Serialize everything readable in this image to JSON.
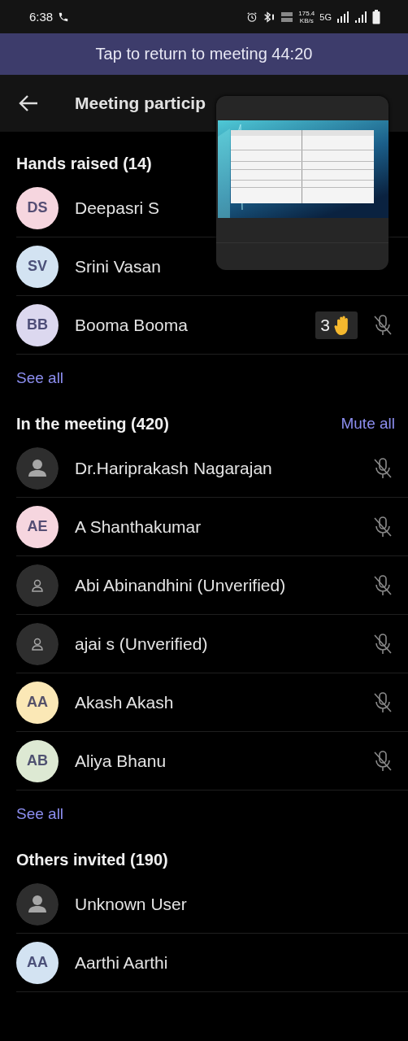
{
  "status_bar": {
    "time": "6:38",
    "speed": "175.4",
    "speed_unit": "KB/s",
    "network": "5G"
  },
  "banner": {
    "text": "Tap to return to meeting 44:20"
  },
  "header": {
    "title": "Meeting particip"
  },
  "sections": [
    {
      "title": "Hands raised (14)",
      "participants": [
        {
          "name": "Deepasri S",
          "avatar": {
            "kind": "initials",
            "initials": "DS",
            "color": "#f6d6df"
          }
        },
        {
          "name": "Srini Vasan",
          "avatar": {
            "kind": "initials",
            "initials": "SV",
            "color": "#d3e3f2"
          }
        },
        {
          "name": "Booma Booma",
          "avatar": {
            "kind": "initials",
            "initials": "BB",
            "color": "#dcd8ef"
          },
          "hand": "3",
          "muted": true
        }
      ],
      "see_all": "See all"
    },
    {
      "title": "In the meeting (420)",
      "action": "Mute all",
      "participants": [
        {
          "name": "Dr.Hariprakash Nagarajan",
          "avatar": {
            "kind": "person"
          },
          "muted": true
        },
        {
          "name": "A Shanthakumar",
          "avatar": {
            "kind": "initials",
            "initials": "AE",
            "color": "#f6d6df"
          },
          "muted": true
        },
        {
          "name": "Abi Abinandhini (Unverified)",
          "avatar": {
            "kind": "unverified"
          },
          "muted": true
        },
        {
          "name": "ajai s (Unverified)",
          "avatar": {
            "kind": "unverified"
          },
          "muted": true
        },
        {
          "name": "Akash Akash",
          "avatar": {
            "kind": "initials",
            "initials": "AA",
            "color": "#fbe8b6"
          },
          "muted": true
        },
        {
          "name": "Aliya Bhanu",
          "avatar": {
            "kind": "initials",
            "initials": "AB",
            "color": "#dde9d3"
          },
          "muted": true
        }
      ],
      "see_all": "See all"
    },
    {
      "title": "Others invited (190)",
      "participants": [
        {
          "name": "Unknown User",
          "avatar": {
            "kind": "person"
          }
        },
        {
          "name": "Aarthi Aarthi",
          "avatar": {
            "kind": "initials",
            "initials": "AA",
            "color": "#d3e3f2"
          }
        }
      ]
    }
  ]
}
